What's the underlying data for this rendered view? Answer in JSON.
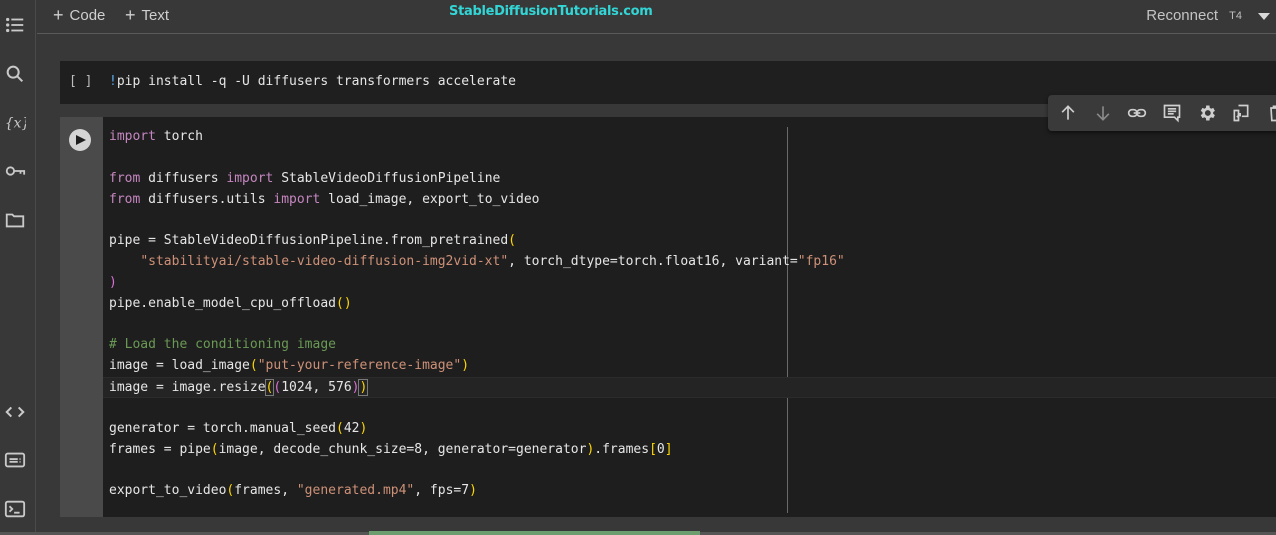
{
  "toolbar": {
    "add_code_label": "Code",
    "add_text_label": "Text",
    "watermark": "StableDiffusionTutorials.com",
    "reconnect_label": "Reconnect",
    "runtime_type": "T4"
  },
  "sidebar": {
    "items": [
      {
        "icon": "table-of-contents-icon"
      },
      {
        "icon": "search-icon"
      },
      {
        "icon": "variables-icon"
      },
      {
        "icon": "secrets-key-icon"
      },
      {
        "icon": "files-folder-icon"
      },
      {
        "icon": "code-snippets-icon"
      },
      {
        "icon": "command-palette-icon"
      },
      {
        "icon": "terminal-icon"
      }
    ]
  },
  "cells": [
    {
      "status": "[ ]",
      "code_bang": "!",
      "code_rest": "pip install -q -U diffusers transformers accelerate"
    },
    {
      "lines": [
        "import torch",
        "",
        "from diffusers import StableVideoDiffusionPipeline",
        "from diffusers.utils import load_image, export_to_video",
        "",
        "pipe = StableVideoDiffusionPipeline.from_pretrained(",
        "    \"stabilityai/stable-video-diffusion-img2vid-xt\", torch_dtype=torch.float16, variant=\"fp16\"",
        ")",
        "pipe.enable_model_cpu_offload()",
        "",
        "# Load the conditioning image",
        "image = load_image(\"put-your-reference-image\")",
        "image = image.resize((1024, 576))",
        "",
        "generator = torch.manual_seed(42)",
        "frames = pipe(image, decode_chunk_size=8, generator=generator).frames[0]",
        "",
        "export_to_video(frames, \"generated.mp4\", fps=7)"
      ]
    }
  ],
  "cell_toolbar": [
    {
      "icon": "move-up-icon"
    },
    {
      "icon": "move-down-icon"
    },
    {
      "icon": "link-icon"
    },
    {
      "icon": "comment-icon"
    },
    {
      "icon": "settings-gear-icon"
    },
    {
      "icon": "mirror-cell-icon"
    },
    {
      "icon": "delete-icon"
    }
  ],
  "progress": {
    "fraction": 0.26
  }
}
